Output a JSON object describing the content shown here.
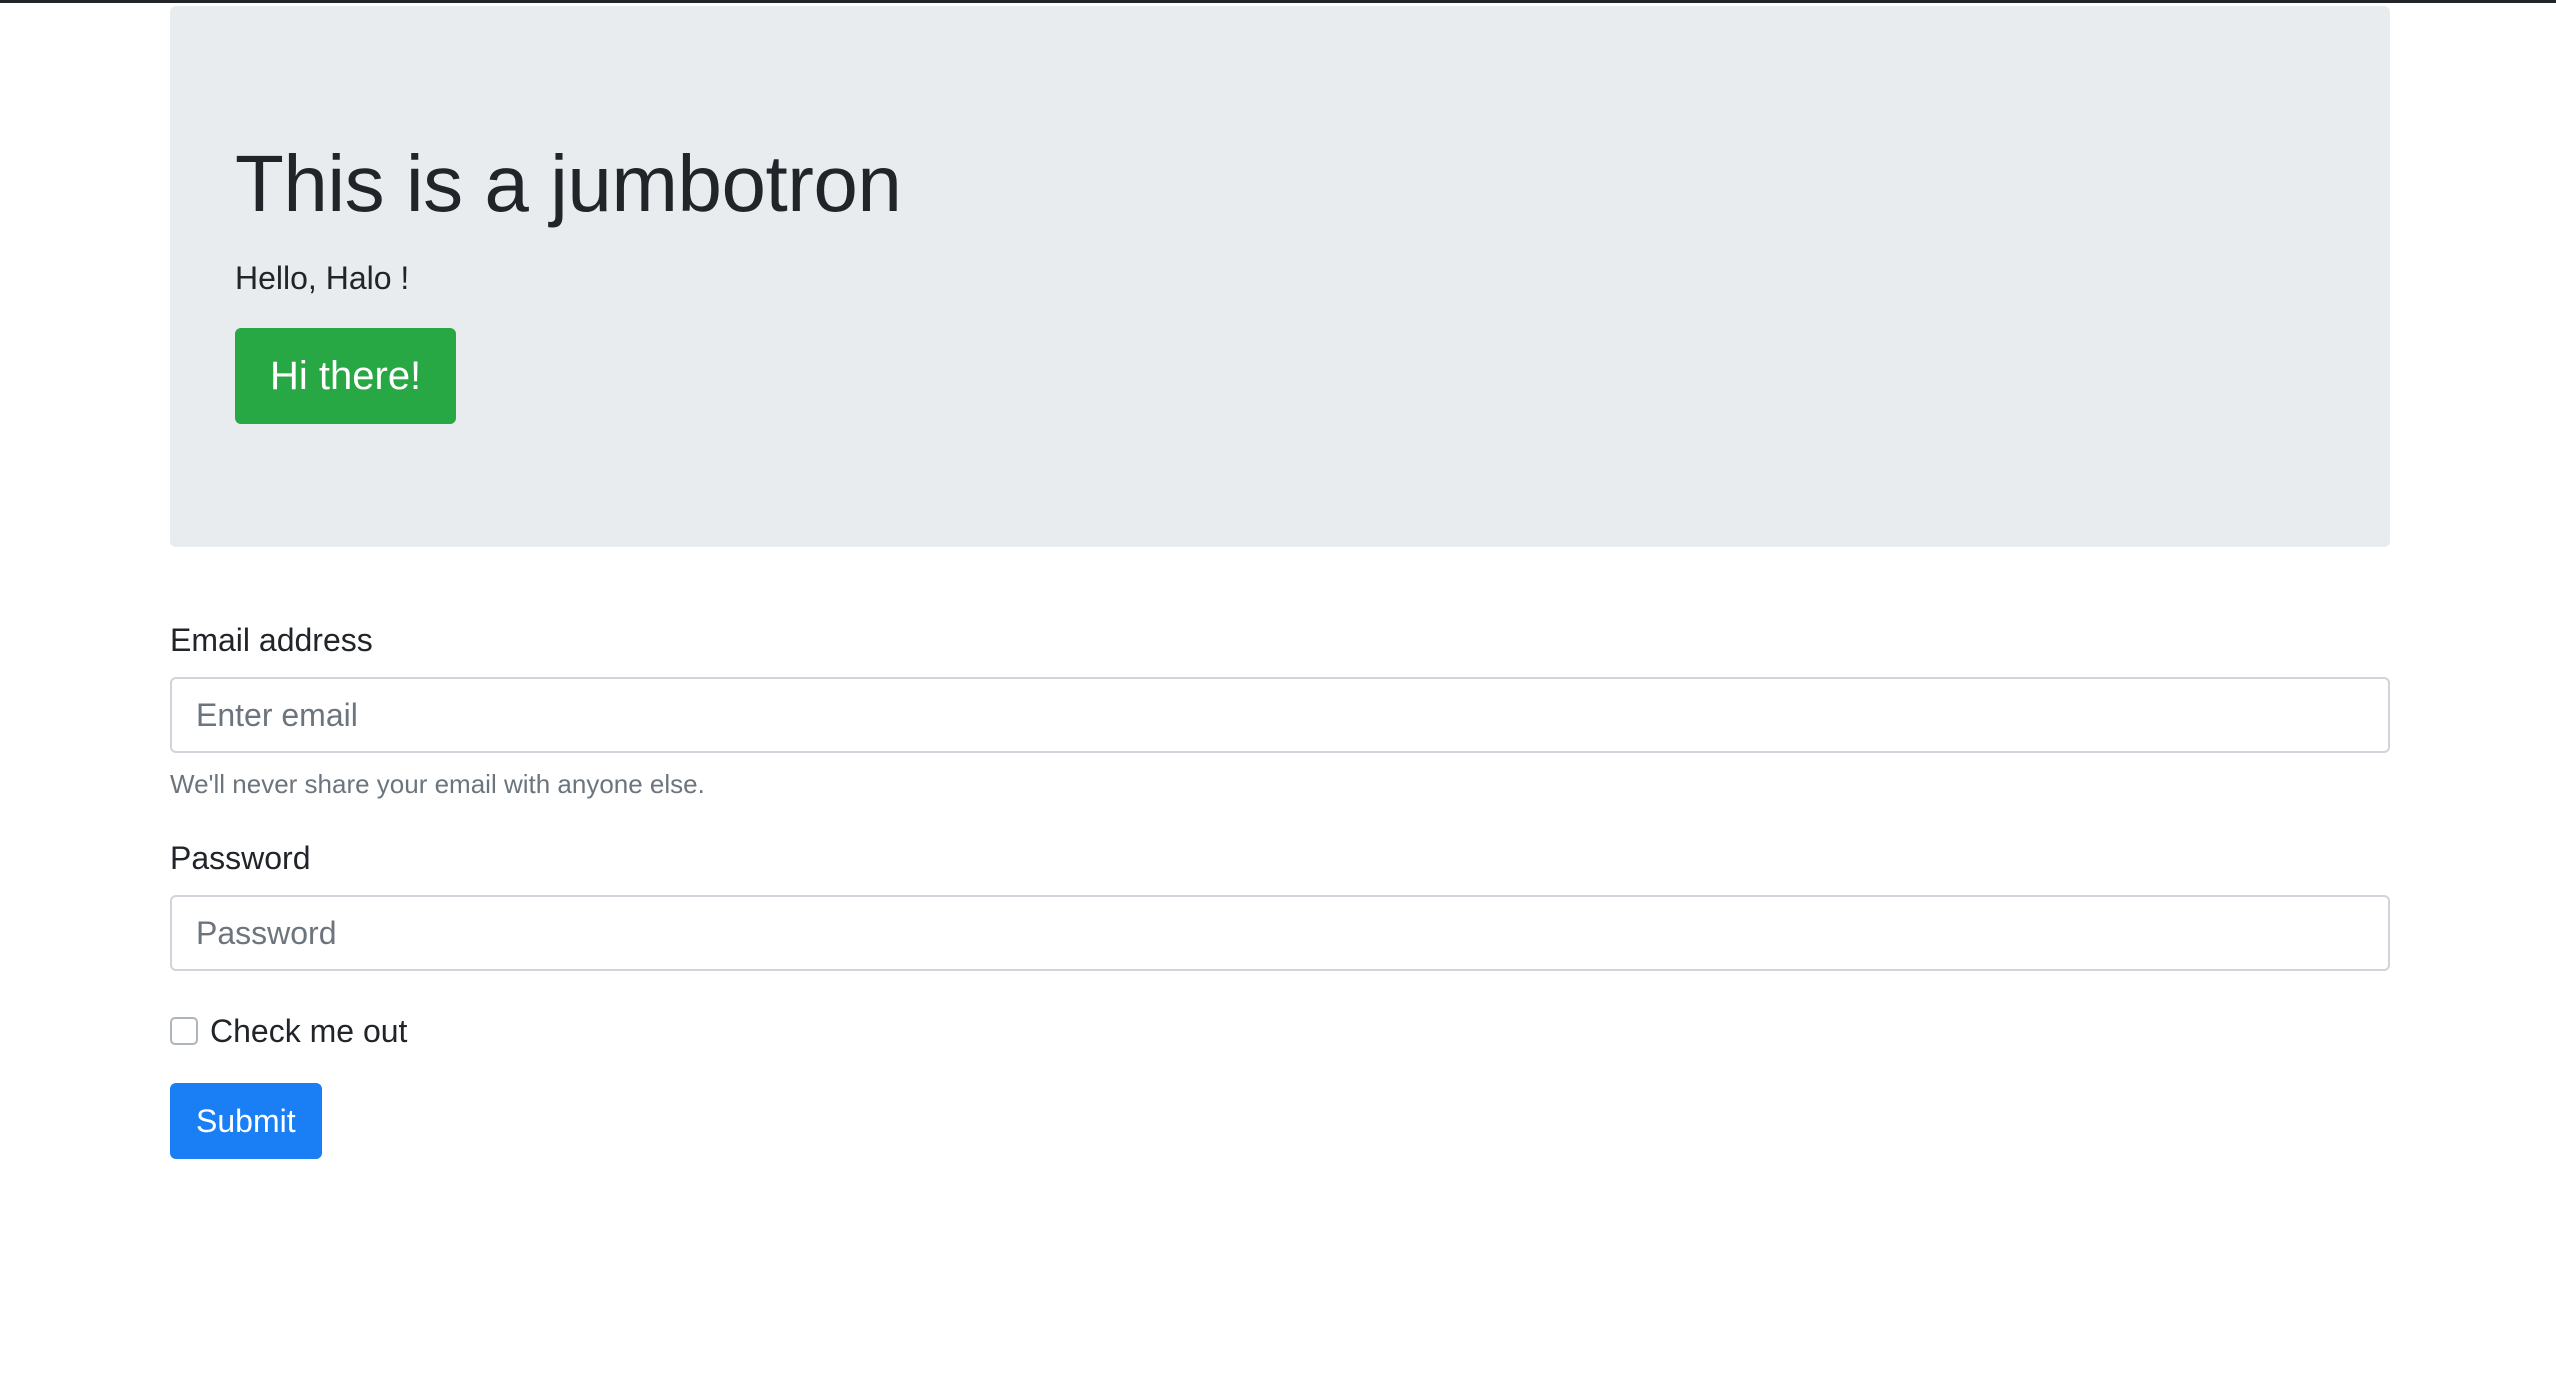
{
  "jumbotron": {
    "title": "This is a jumbotron",
    "text": "Hello, Halo !",
    "button_label": "Hi there!"
  },
  "form": {
    "email_label": "Email address",
    "email_placeholder": "Enter email",
    "email_value": "",
    "email_help": "We'll never share your email with anyone else.",
    "password_label": "Password",
    "password_placeholder": "Password",
    "password_value": "",
    "checkbox_label": "Check me out",
    "checkbox_checked": false,
    "submit_label": "Submit"
  },
  "colors": {
    "jumbotron_bg": "#e9ecef",
    "success": "#28a745",
    "primary": "#1a7ff5",
    "muted_text": "#6c757d",
    "body_text": "#212529"
  }
}
